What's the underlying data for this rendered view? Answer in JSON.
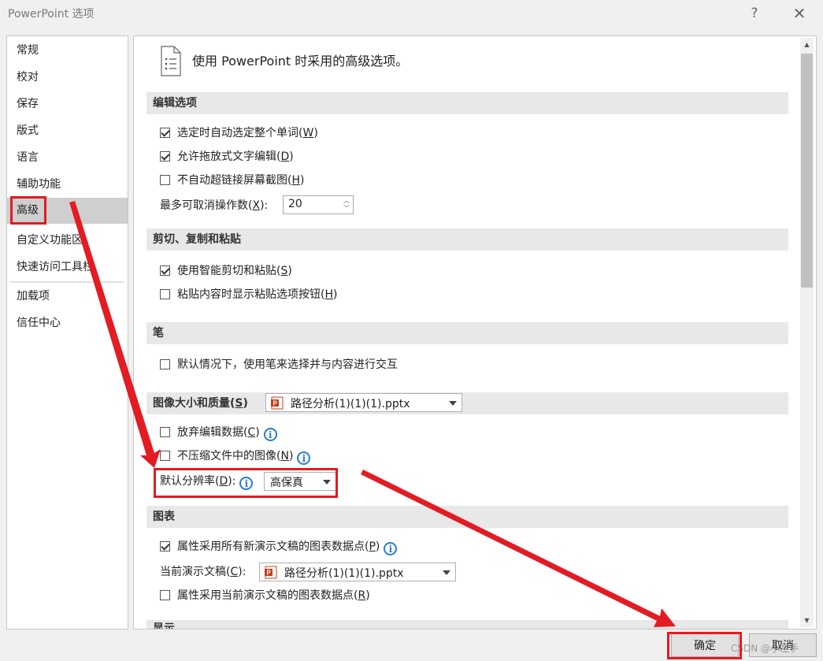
{
  "window": {
    "title": "PowerPoint 选项",
    "help_glyph": "?",
    "close_glyph": "✕"
  },
  "nav": {
    "items": [
      {
        "label": "常规"
      },
      {
        "label": "校对"
      },
      {
        "label": "保存"
      },
      {
        "label": "版式"
      },
      {
        "label": "语言"
      },
      {
        "label": "辅助功能"
      },
      {
        "label": "高级",
        "selected": true
      },
      {
        "label": "自定义功能区"
      },
      {
        "label": "快速访问工具栏"
      },
      {
        "label": "加载项"
      },
      {
        "label": "信任中心"
      }
    ]
  },
  "content": {
    "header": "使用 PowerPoint 时采用的高级选项。",
    "editing": {
      "title": "编辑选项",
      "options": [
        {
          "pre": "选定时自动选定整个单词(",
          "key": "W",
          "post": ")",
          "checked": true
        },
        {
          "pre": "允许拖放式文字编辑(",
          "key": "D",
          "post": ")",
          "checked": true
        },
        {
          "pre": "不自动超链接屏幕截图(",
          "key": "H",
          "post": ")",
          "checked": false
        }
      ],
      "undo": {
        "pre": "最多可取消操作数(",
        "key": "X",
        "post": "):",
        "value": "20"
      }
    },
    "clipboard": {
      "title": "剪切、复制和粘贴",
      "options": [
        {
          "pre": "使用智能剪切和粘贴(",
          "key": "S",
          "post": ")",
          "checked": true
        },
        {
          "pre": "粘贴内容时显示粘贴选项按钮(",
          "key": "H",
          "post": ")",
          "checked": false
        }
      ]
    },
    "pen": {
      "title": "笔",
      "options": [
        {
          "label": "默认情况下，使用笔来选择并与内容进行交互",
          "checked": false
        }
      ]
    },
    "image": {
      "title_pre": "图像大小和质量(",
      "title_key": "S",
      "title_post": ")",
      "file": "路径分析(1)(1)(1).pptx",
      "options": [
        {
          "pre": "放弃编辑数据(",
          "key": "C",
          "post": ")",
          "checked": false
        },
        {
          "pre": "不压缩文件中的图像(",
          "key": "N",
          "post": ")",
          "checked": false
        }
      ],
      "resolution": {
        "pre": "默认分辨率(",
        "key": "D",
        "post": "):",
        "value": "高保真"
      }
    },
    "chart": {
      "title": "图表",
      "options": [
        {
          "pre": "属性采用所有新演示文稿的图表数据点(",
          "key": "P",
          "post": ")",
          "checked": true
        },
        {
          "pre": "属性采用当前演示文稿的图表数据点(",
          "key": "R",
          "post": ")",
          "checked": false
        }
      ],
      "current": {
        "pre": "当前演示文稿(",
        "key": "C",
        "post": "):",
        "file": "路径分析(1)(1)(1).pptx"
      }
    },
    "next_section_partial": "显示"
  },
  "buttons": {
    "ok": "确定",
    "cancel": "取消"
  },
  "watermark": "CSDN @小左手",
  "colors": {
    "annotation": "#e31b23",
    "info": "#2a7dd2",
    "pptx": "#c43e1c"
  },
  "icons": [
    "question-icon",
    "close-icon",
    "document-icon",
    "info-icon",
    "pptx-file-icon",
    "dropdown-caret-icon",
    "spin-arrows-icon"
  ]
}
